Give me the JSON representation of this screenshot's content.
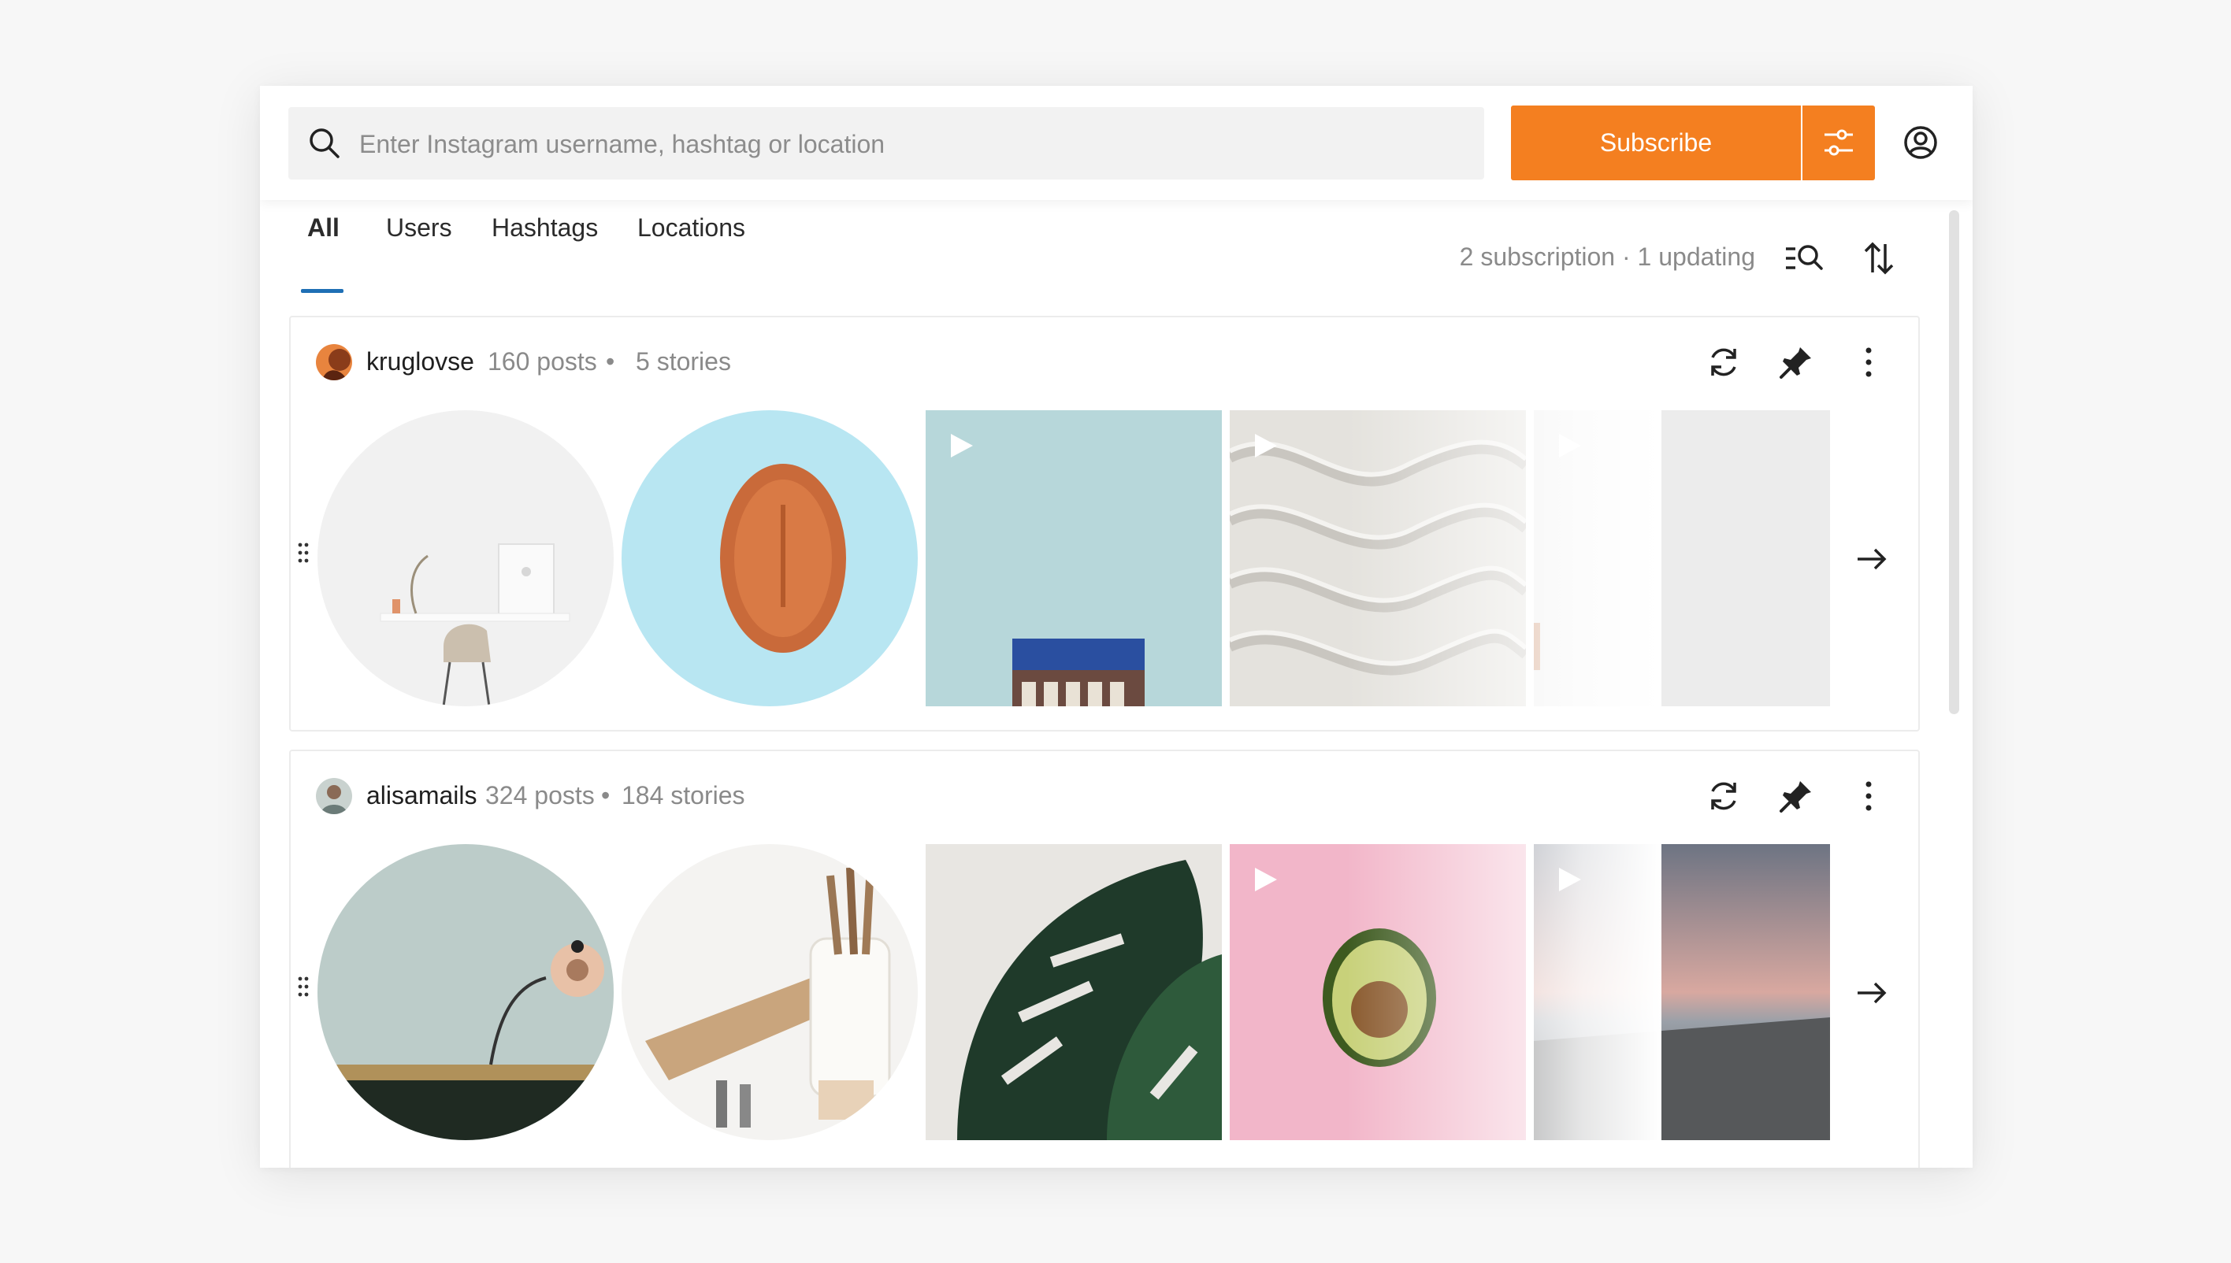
{
  "search": {
    "placeholder": "Enter Instagram username, hashtag or location",
    "icon": "search-icon"
  },
  "header": {
    "subscribe_label": "Subscribe",
    "filters_icon": "sliders-icon",
    "account_icon": "user-circle-icon"
  },
  "tabs": [
    {
      "label": "All",
      "active": true
    },
    {
      "label": "Users",
      "active": false
    },
    {
      "label": "Hashtags",
      "active": false
    },
    {
      "label": "Locations",
      "active": false
    }
  ],
  "status": {
    "counter": "2 subscription · 1 updating"
  },
  "colors": {
    "accent": "#f47f20",
    "tab_underline": "#1f6fb5"
  },
  "subscriptions": [
    {
      "username": "kruglovse",
      "posts": "160 posts",
      "separator": "•",
      "stories": "5 stories",
      "thumbs": [
        "story-desk-chair",
        "story-terracotta-dish",
        "video-blue-building",
        "video-sand-dunes",
        "video-white-wall"
      ]
    },
    {
      "username": "alisamails",
      "posts": "324 posts",
      "separator": "•",
      "stories": "184 stories",
      "thumbs": [
        "story-wall-lamp",
        "story-kitchen-utensils",
        "post-monstera-leaf",
        "video-avocado-pink",
        "video-beach-sunset"
      ]
    }
  ]
}
